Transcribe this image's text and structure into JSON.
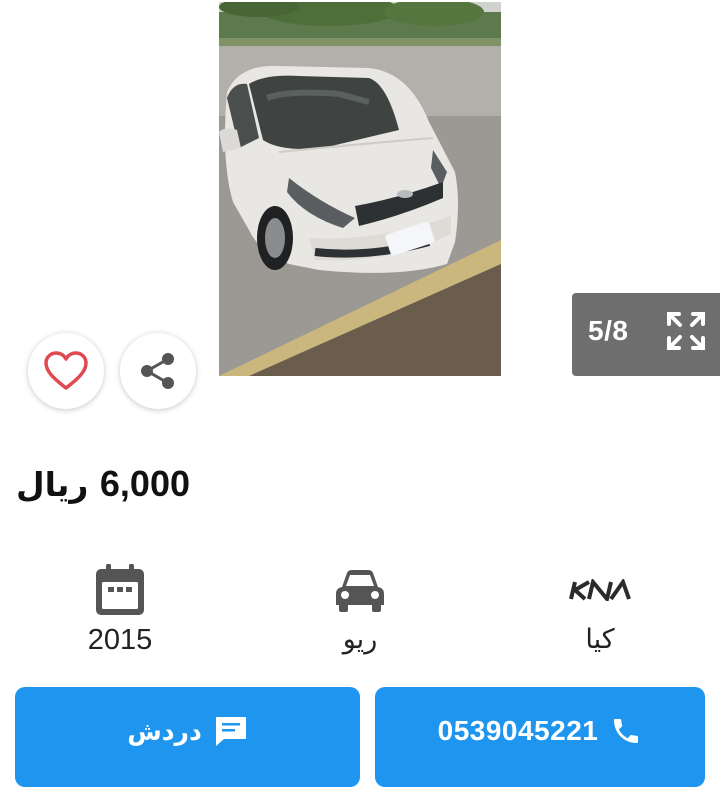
{
  "gallery": {
    "counter": "5/8",
    "icons": {
      "prev": "chevron-left-icon",
      "next": "chevron-right-icon",
      "expand": "expand-icon",
      "favorite": "heart-icon",
      "share": "share-icon"
    }
  },
  "listing": {
    "price_amount": "6,000",
    "price_currency": "ريال"
  },
  "specs": {
    "year": "2015",
    "model": "ريو",
    "make": "كيا",
    "make_logo_text": "KIA",
    "icons": {
      "year": "calendar-icon",
      "model": "car-icon",
      "make": "kia-logo"
    }
  },
  "actions": {
    "chat_label": "دردش",
    "phone": "0539045221",
    "icons": {
      "chat": "chat-icon",
      "call": "phone-icon"
    }
  },
  "colors": {
    "accent": "#1e96f0",
    "counter_bg": "#6e6e6e",
    "heart": "#e0494f",
    "icon_gray": "#555555"
  }
}
